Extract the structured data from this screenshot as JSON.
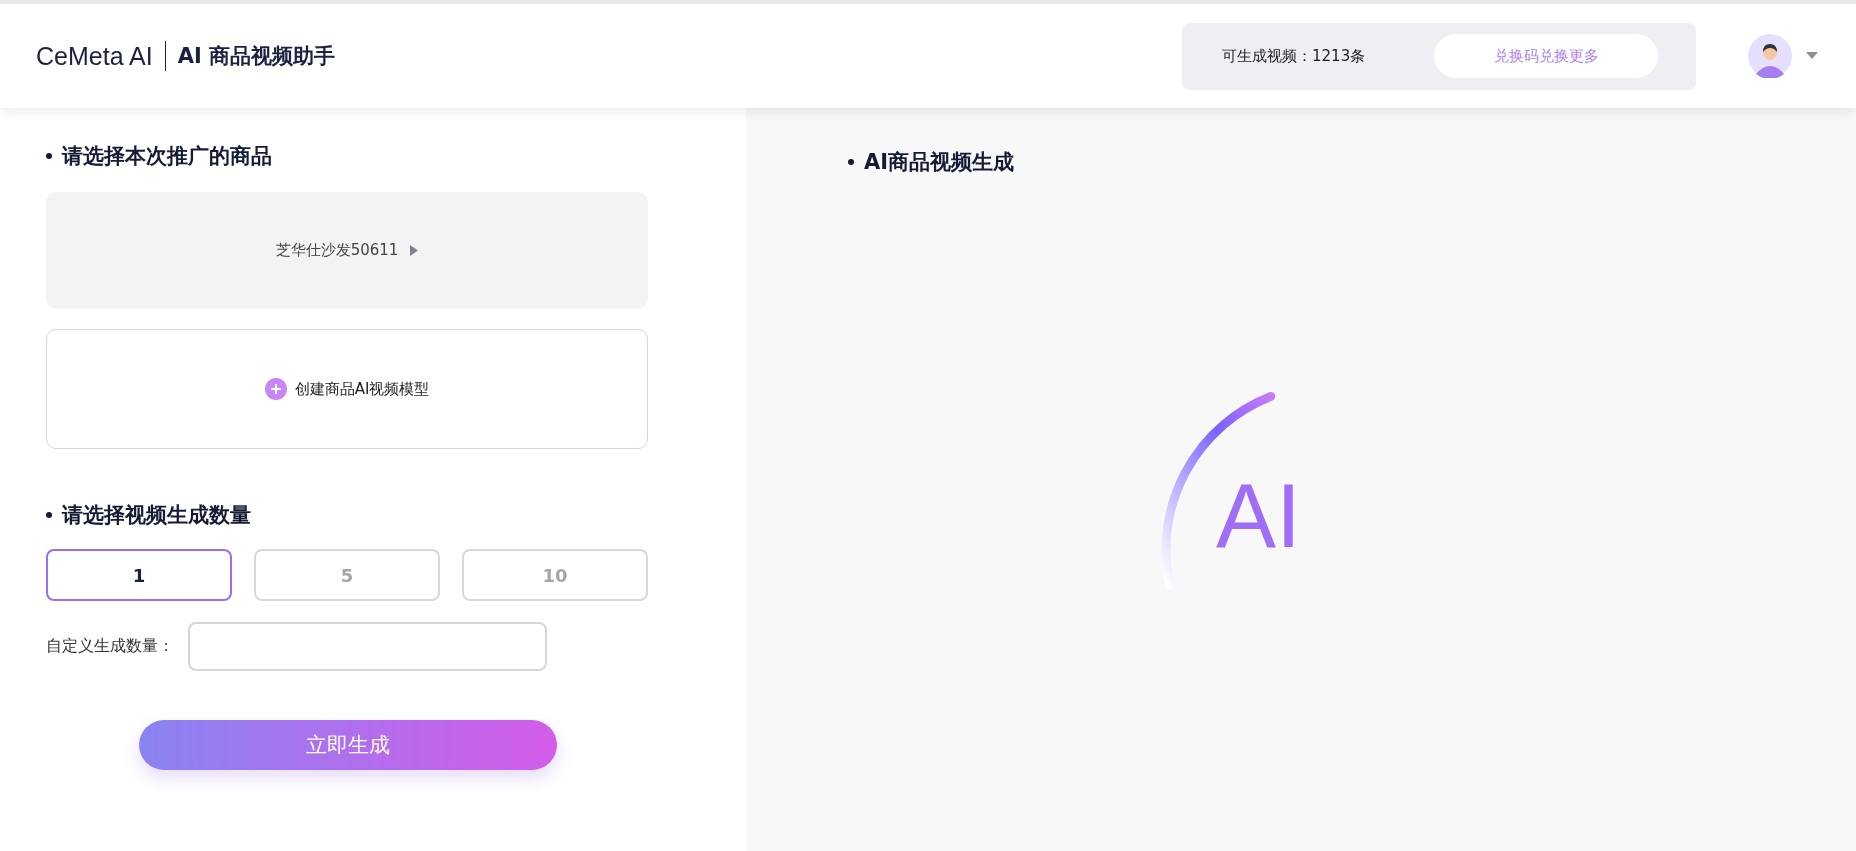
{
  "header": {
    "logo": "CeMeta AI",
    "title": "AI 商品视频助手",
    "quota": "可生成视频：1213条",
    "redeem_button": "兑换码兑换更多"
  },
  "product_section": {
    "heading": "请选择本次推广的商品",
    "product": "芝华仕沙发50611",
    "create_model": "创建商品AI视频模型"
  },
  "quantity_section": {
    "heading": "请选择视频生成数量",
    "options": [
      {
        "label": "1",
        "selected": true
      },
      {
        "label": "5",
        "selected": false
      },
      {
        "label": "10",
        "selected": false
      }
    ],
    "custom_label": "自定义生成数量：",
    "generate_button": "立即生成"
  },
  "preview": {
    "heading": "AI商品视频生成",
    "badge": "AI"
  }
}
